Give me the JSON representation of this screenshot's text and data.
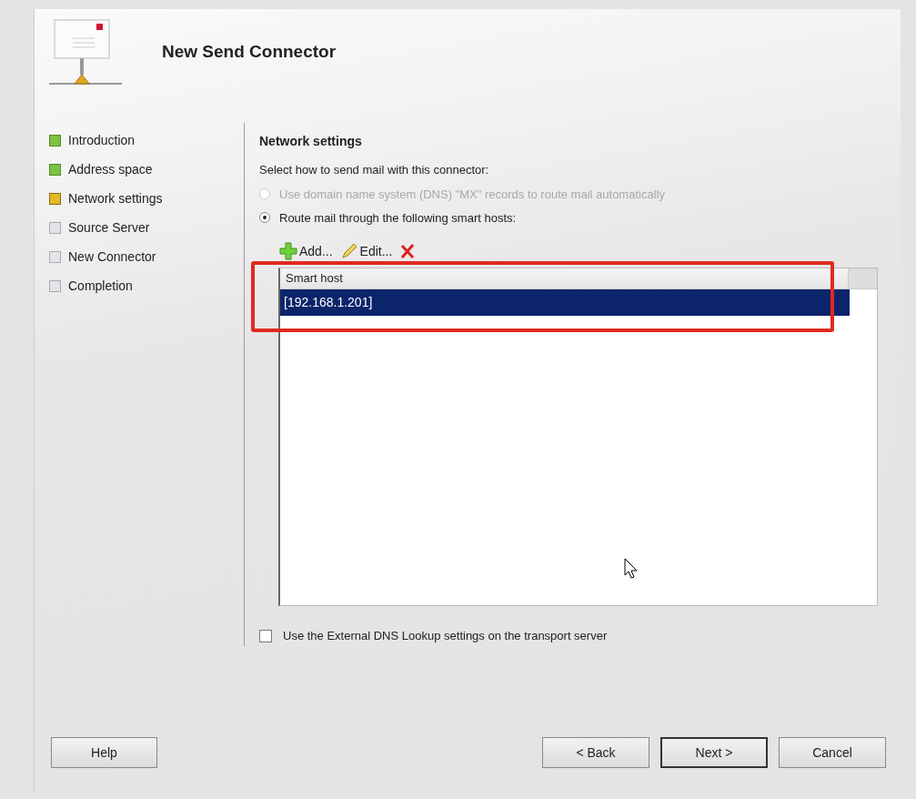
{
  "window": {
    "title": "New Send Connector"
  },
  "steps": [
    {
      "label": "Introduction",
      "kind": "done"
    },
    {
      "label": "Address space",
      "kind": "done"
    },
    {
      "label": "Network settings",
      "kind": "current"
    },
    {
      "label": "Source Server",
      "kind": "pending"
    },
    {
      "label": "New Connector",
      "kind": "pending"
    },
    {
      "label": "Completion",
      "kind": "pending"
    }
  ],
  "section": {
    "title": "Network settings",
    "prompt": "Select how to send mail with this connector:"
  },
  "routing_options": [
    {
      "label": "Use domain name system (DNS) \"MX\" records to route mail automatically",
      "selected": false,
      "disabled": true
    },
    {
      "label": "Route mail through the following smart hosts:",
      "selected": true,
      "disabled": false
    }
  ],
  "toolbar": [
    {
      "kind": "add",
      "label": "Add..."
    },
    {
      "kind": "edit",
      "label": "Edit..."
    },
    {
      "kind": "remove"
    }
  ],
  "table": {
    "columns": [
      "Smart host"
    ],
    "rows": [
      {
        "cells": [
          "[192.168.1.201]"
        ],
        "selected": true
      }
    ]
  },
  "external_dns": {
    "label": "Use the External DNS Lookup settings on the transport server",
    "checked": false
  },
  "buttons": [
    {
      "label": "Help",
      "kind": "help"
    },
    {
      "label": "< Back",
      "kind": "back"
    },
    {
      "label": "Next >",
      "kind": "next",
      "default": true
    },
    {
      "label": "Cancel",
      "kind": "cancel"
    }
  ]
}
